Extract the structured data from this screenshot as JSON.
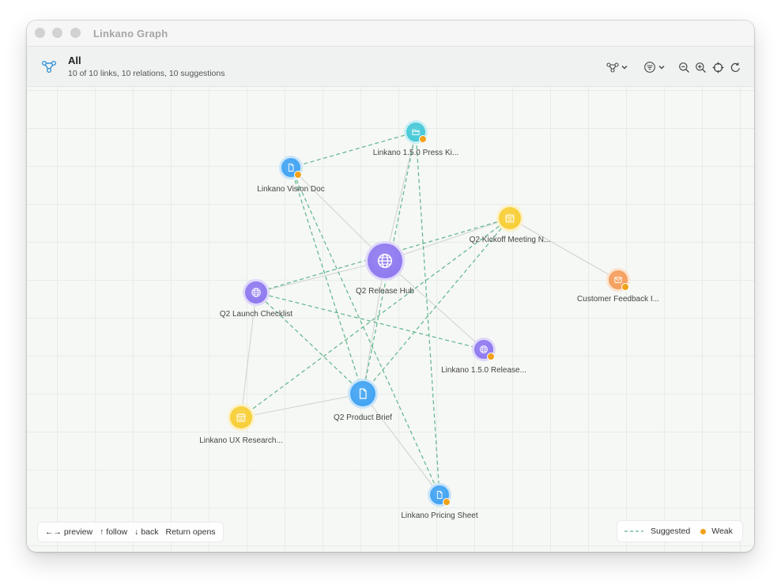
{
  "window": {
    "title": "Linkano Graph"
  },
  "header": {
    "scope_title": "All",
    "scope_subtitle": "10 of 10 links, 10 relations, 10 suggestions",
    "toolbar": [
      {
        "icon": "layout-icon"
      },
      {
        "icon": "filter-icon"
      },
      {
        "icon": "zoom-out-icon"
      },
      {
        "icon": "zoom-in-icon"
      },
      {
        "icon": "recenter-icon"
      },
      {
        "icon": "reload-icon"
      }
    ]
  },
  "graph": {
    "nodes": [
      {
        "id": "hub",
        "label": "Q2 Release Hub",
        "icon": "globe-icon",
        "color": "#8b74ef",
        "weak": false
      },
      {
        "id": "vision",
        "label": "Linkano Vision Doc",
        "icon": "document-icon",
        "color": "#3aa0f2",
        "weak": true
      },
      {
        "id": "press",
        "label": "Linkano 1.5.0 Press Ki...",
        "icon": "folder-icon",
        "color": "#3ec6d6",
        "weak": true
      },
      {
        "id": "kickoff",
        "label": "Q2 Kickoff Meeting N...",
        "icon": "calendar-icon",
        "color": "#f7cc2e",
        "weak": false
      },
      {
        "id": "feedback",
        "label": "Customer Feedback I...",
        "icon": "mail-icon",
        "color": "#f59a55",
        "weak": true
      },
      {
        "id": "checklist",
        "label": "Q2 Launch Checklist",
        "icon": "globe-icon",
        "color": "#8b74ef",
        "weak": false
      },
      {
        "id": "release",
        "label": "Linkano 1.5.0 Release...",
        "icon": "globe-icon",
        "color": "#8b74ef",
        "weak": true
      },
      {
        "id": "brief",
        "label": "Q2 Product Brief",
        "icon": "document-icon",
        "color": "#3aa0f2",
        "weak": false
      },
      {
        "id": "ux",
        "label": "Linkano UX Research...",
        "icon": "calendar-icon",
        "color": "#f7cc2e",
        "weak": false
      },
      {
        "id": "pricing",
        "label": "Linkano Pricing Sheet",
        "icon": "document-icon",
        "color": "#3aa0f2",
        "weak": true
      }
    ],
    "relations": [
      [
        "hub",
        "vision"
      ],
      [
        "hub",
        "press"
      ],
      [
        "hub",
        "kickoff"
      ],
      [
        "hub",
        "checklist"
      ],
      [
        "hub",
        "release"
      ],
      [
        "hub",
        "brief"
      ],
      [
        "kickoff",
        "feedback"
      ],
      [
        "checklist",
        "ux"
      ],
      [
        "brief",
        "ux"
      ],
      [
        "brief",
        "pricing"
      ]
    ],
    "suggestions": [
      [
        "vision",
        "press"
      ],
      [
        "vision",
        "brief"
      ],
      [
        "vision",
        "pricing"
      ],
      [
        "press",
        "brief"
      ],
      [
        "press",
        "pricing"
      ],
      [
        "kickoff",
        "checklist"
      ],
      [
        "kickoff",
        "brief"
      ],
      [
        "kickoff",
        "ux"
      ],
      [
        "checklist",
        "release"
      ],
      [
        "checklist",
        "brief"
      ]
    ],
    "colors": {
      "relation": "#cfd5d3",
      "suggestion": "#5fb58c",
      "weak": "#f2a21b"
    }
  },
  "footer": {
    "hints": [
      {
        "key": "←→",
        "label": "preview"
      },
      {
        "key": "↑",
        "label": "follow"
      },
      {
        "key": "↓",
        "label": "back"
      },
      {
        "key": "",
        "label": "Return opens"
      }
    ],
    "legend": {
      "suggested": "Suggested",
      "weak": "Weak"
    }
  }
}
